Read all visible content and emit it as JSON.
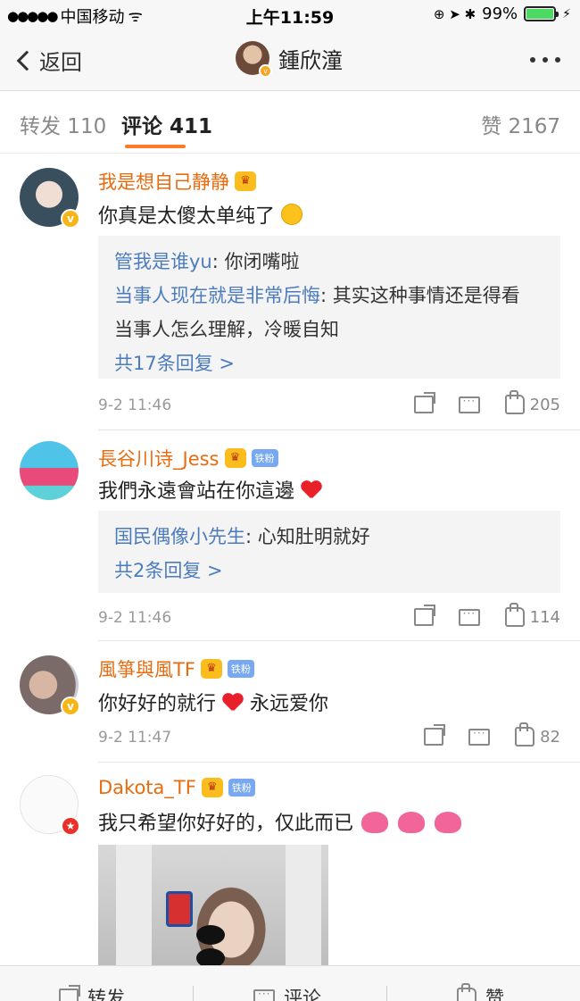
{
  "status_bar": {
    "signal": "●●●●●",
    "carrier": "中国移动",
    "wifi": "ᯤ",
    "time": "上午11:59",
    "icons": "⊕ ➤ ✱",
    "battery": "99%",
    "charging": "⚡"
  },
  "nav": {
    "back_label": "返回",
    "title": "鍾欣潼",
    "more": "more-icon"
  },
  "tabs": {
    "repost": "转发 110",
    "comments": "评论 411",
    "likes": "赞 2167",
    "accent_color": "#fb7b26"
  },
  "comments": [
    {
      "user": "我是想自己静静",
      "text": "你真是太傻太单纯了",
      "replies": [
        {
          "user": "管我是谁yu",
          "text": ": 你闭嘴啦"
        },
        {
          "user": "当事人现在就是非常后悔",
          "text": ": 其实这种事情还是得看"
        },
        {
          "user": "",
          "text": "当事人怎么理解，冷暖自知"
        }
      ],
      "more_replies": "共17条回复 >",
      "time": "9-2 11:46",
      "likes": "205"
    },
    {
      "user": "長谷川诗_Jess",
      "badge": "铁粉",
      "text": "我們永遠會站在你這邊",
      "replies": [
        {
          "user": "国民偶像小先生",
          "text": ": 心知肚明就好"
        }
      ],
      "more_replies": "共2条回复 >",
      "time": "9-2 11:46",
      "likes": "114"
    },
    {
      "user": "風箏與風TF",
      "badge": "铁粉",
      "text_a": "你好好的就行",
      "text_b": "永远爱你",
      "time": "9-2 11:47",
      "likes": "82"
    },
    {
      "user": "Dakota_TF",
      "badge": "铁粉",
      "text": "我只希望你好好的，仅此而已"
    }
  ],
  "bottom_bar": {
    "repost": "转发",
    "comment": "评论",
    "like": "赞"
  },
  "colors": {
    "name_orange": "#e86b0f",
    "reply_blue": "#4d7cbd",
    "verified_gold": "#f8b518"
  }
}
